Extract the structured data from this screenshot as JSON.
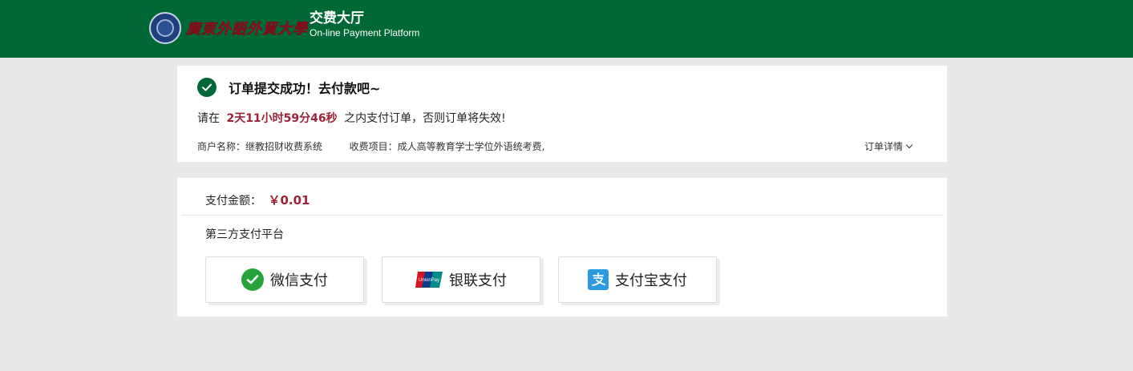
{
  "header": {
    "university_name": "廣東外語外貿大學",
    "title": "交费大厅",
    "subtitle": "On-line Payment Platform",
    "bg_color": "#006837"
  },
  "order": {
    "success_title": "订单提交成功！去付款吧~",
    "deadline_prefix": "请在",
    "countdown": "2天11小时59分46秒",
    "deadline_suffix": "之内支付订单，否则订单将失效!",
    "merchant_label": "商户名称：继教招财收费系统",
    "item_label": "收费项目：成人高等教育学士学位外语统考费,",
    "detail_link": "订单详情",
    "accent_color": "#9b2335"
  },
  "payment": {
    "amount_label": "支付金额：",
    "amount_value": "￥0.01",
    "platform_label": "第三方支付平台",
    "methods": [
      {
        "label": "微信支付",
        "icon": "wechat-icon"
      },
      {
        "label": "银联支付",
        "icon": "unionpay-icon"
      },
      {
        "label": "支付宝支付",
        "icon": "alipay-icon"
      }
    ]
  }
}
